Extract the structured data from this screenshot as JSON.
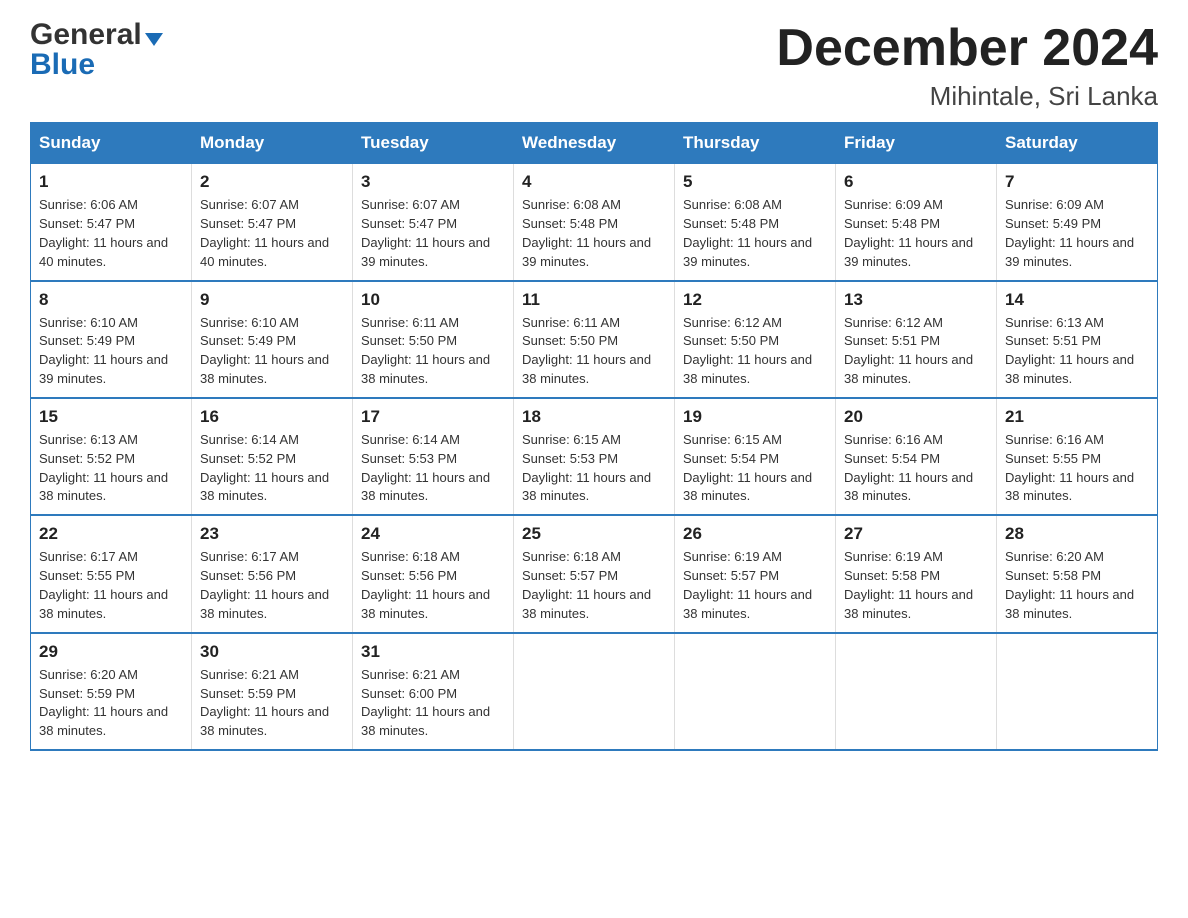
{
  "logo": {
    "general": "General",
    "blue": "Blue",
    "triangle": "▼"
  },
  "header": {
    "month_year": "December 2024",
    "location": "Mihintale, Sri Lanka"
  },
  "weekdays": [
    "Sunday",
    "Monday",
    "Tuesday",
    "Wednesday",
    "Thursday",
    "Friday",
    "Saturday"
  ],
  "weeks": [
    [
      {
        "day": "1",
        "sunrise": "6:06 AM",
        "sunset": "5:47 PM",
        "daylight": "11 hours and 40 minutes."
      },
      {
        "day": "2",
        "sunrise": "6:07 AM",
        "sunset": "5:47 PM",
        "daylight": "11 hours and 40 minutes."
      },
      {
        "day": "3",
        "sunrise": "6:07 AM",
        "sunset": "5:47 PM",
        "daylight": "11 hours and 39 minutes."
      },
      {
        "day": "4",
        "sunrise": "6:08 AM",
        "sunset": "5:48 PM",
        "daylight": "11 hours and 39 minutes."
      },
      {
        "day": "5",
        "sunrise": "6:08 AM",
        "sunset": "5:48 PM",
        "daylight": "11 hours and 39 minutes."
      },
      {
        "day": "6",
        "sunrise": "6:09 AM",
        "sunset": "5:48 PM",
        "daylight": "11 hours and 39 minutes."
      },
      {
        "day": "7",
        "sunrise": "6:09 AM",
        "sunset": "5:49 PM",
        "daylight": "11 hours and 39 minutes."
      }
    ],
    [
      {
        "day": "8",
        "sunrise": "6:10 AM",
        "sunset": "5:49 PM",
        "daylight": "11 hours and 39 minutes."
      },
      {
        "day": "9",
        "sunrise": "6:10 AM",
        "sunset": "5:49 PM",
        "daylight": "11 hours and 38 minutes."
      },
      {
        "day": "10",
        "sunrise": "6:11 AM",
        "sunset": "5:50 PM",
        "daylight": "11 hours and 38 minutes."
      },
      {
        "day": "11",
        "sunrise": "6:11 AM",
        "sunset": "5:50 PM",
        "daylight": "11 hours and 38 minutes."
      },
      {
        "day": "12",
        "sunrise": "6:12 AM",
        "sunset": "5:50 PM",
        "daylight": "11 hours and 38 minutes."
      },
      {
        "day": "13",
        "sunrise": "6:12 AM",
        "sunset": "5:51 PM",
        "daylight": "11 hours and 38 minutes."
      },
      {
        "day": "14",
        "sunrise": "6:13 AM",
        "sunset": "5:51 PM",
        "daylight": "11 hours and 38 minutes."
      }
    ],
    [
      {
        "day": "15",
        "sunrise": "6:13 AM",
        "sunset": "5:52 PM",
        "daylight": "11 hours and 38 minutes."
      },
      {
        "day": "16",
        "sunrise": "6:14 AM",
        "sunset": "5:52 PM",
        "daylight": "11 hours and 38 minutes."
      },
      {
        "day": "17",
        "sunrise": "6:14 AM",
        "sunset": "5:53 PM",
        "daylight": "11 hours and 38 minutes."
      },
      {
        "day": "18",
        "sunrise": "6:15 AM",
        "sunset": "5:53 PM",
        "daylight": "11 hours and 38 minutes."
      },
      {
        "day": "19",
        "sunrise": "6:15 AM",
        "sunset": "5:54 PM",
        "daylight": "11 hours and 38 minutes."
      },
      {
        "day": "20",
        "sunrise": "6:16 AM",
        "sunset": "5:54 PM",
        "daylight": "11 hours and 38 minutes."
      },
      {
        "day": "21",
        "sunrise": "6:16 AM",
        "sunset": "5:55 PM",
        "daylight": "11 hours and 38 minutes."
      }
    ],
    [
      {
        "day": "22",
        "sunrise": "6:17 AM",
        "sunset": "5:55 PM",
        "daylight": "11 hours and 38 minutes."
      },
      {
        "day": "23",
        "sunrise": "6:17 AM",
        "sunset": "5:56 PM",
        "daylight": "11 hours and 38 minutes."
      },
      {
        "day": "24",
        "sunrise": "6:18 AM",
        "sunset": "5:56 PM",
        "daylight": "11 hours and 38 minutes."
      },
      {
        "day": "25",
        "sunrise": "6:18 AM",
        "sunset": "5:57 PM",
        "daylight": "11 hours and 38 minutes."
      },
      {
        "day": "26",
        "sunrise": "6:19 AM",
        "sunset": "5:57 PM",
        "daylight": "11 hours and 38 minutes."
      },
      {
        "day": "27",
        "sunrise": "6:19 AM",
        "sunset": "5:58 PM",
        "daylight": "11 hours and 38 minutes."
      },
      {
        "day": "28",
        "sunrise": "6:20 AM",
        "sunset": "5:58 PM",
        "daylight": "11 hours and 38 minutes."
      }
    ],
    [
      {
        "day": "29",
        "sunrise": "6:20 AM",
        "sunset": "5:59 PM",
        "daylight": "11 hours and 38 minutes."
      },
      {
        "day": "30",
        "sunrise": "6:21 AM",
        "sunset": "5:59 PM",
        "daylight": "11 hours and 38 minutes."
      },
      {
        "day": "31",
        "sunrise": "6:21 AM",
        "sunset": "6:00 PM",
        "daylight": "11 hours and 38 minutes."
      },
      null,
      null,
      null,
      null
    ]
  ]
}
